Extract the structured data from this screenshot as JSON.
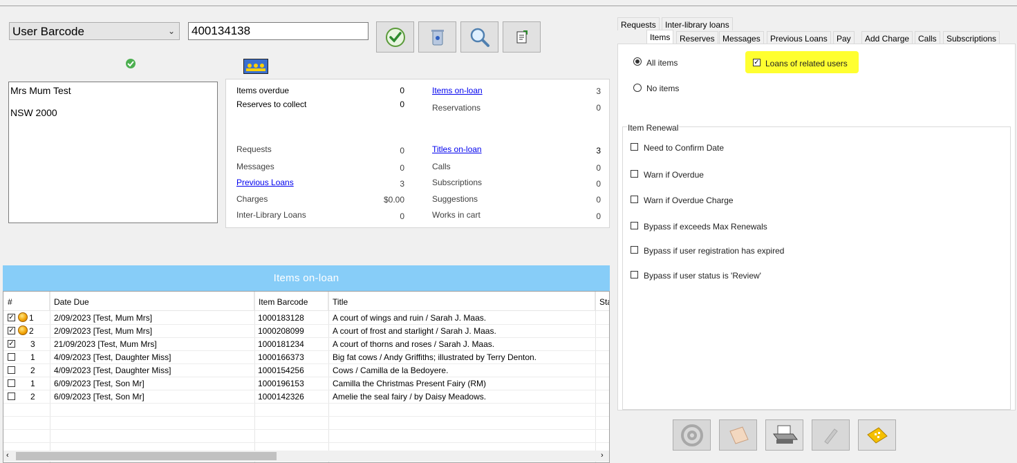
{
  "search": {
    "type_label": "User Barcode",
    "barcode_value": "400134138"
  },
  "address": {
    "lines": [
      "Mrs Mum Test",
      "NSW 2000"
    ]
  },
  "stats": {
    "items_overdue": {
      "label": "Items overdue",
      "value": "0"
    },
    "reserves_to_collect": {
      "label": "Reserves to collect",
      "value": "0"
    },
    "items_on_loan": {
      "label": "Items on-loan",
      "value": "3"
    },
    "reservations": {
      "label": "Reservations",
      "value": "0"
    },
    "requests": {
      "label": "Requests",
      "value": "0"
    },
    "titles_on_loan": {
      "label": "Titles on-loan",
      "value": "3"
    },
    "messages": {
      "label": "Messages",
      "value": "0"
    },
    "calls": {
      "label": "Calls",
      "value": "0"
    },
    "previous_loans": {
      "label": "Previous Loans",
      "value": "3"
    },
    "subscriptions": {
      "label": "Subscriptions",
      "value": "0"
    },
    "charges": {
      "label": "Charges",
      "value": "$0.00"
    },
    "suggestions": {
      "label": "Suggestions",
      "value": "0"
    },
    "ill": {
      "label": "Inter-Library Loans",
      "value": "0"
    },
    "works_in_cart": {
      "label": "Works in cart",
      "value": "0"
    }
  },
  "loans": {
    "title": "Items on-loan",
    "columns": [
      "#",
      "Date Due",
      "Item Barcode",
      "Title",
      "Sta"
    ],
    "rows": [
      {
        "checked": true,
        "coin": true,
        "num": "1",
        "due": "2/09/2023 [Test, Mum Mrs]",
        "barcode": "1000183128",
        "title": "A court of wings and ruin / Sarah J. Maas."
      },
      {
        "checked": true,
        "coin": true,
        "num": "2",
        "due": "2/09/2023 [Test, Mum Mrs]",
        "barcode": "1000208099",
        "title": "A court of frost and starlight / Sarah J. Maas."
      },
      {
        "checked": true,
        "coin": false,
        "num": "3",
        "due": "21/09/2023 [Test, Mum Mrs]",
        "barcode": "1000181234",
        "title": "A court of thorns and roses / Sarah J. Maas."
      },
      {
        "checked": false,
        "coin": false,
        "num": "1",
        "due": "4/09/2023 [Test, Daughter Miss]",
        "barcode": "1000166373",
        "title": "Big fat cows / Andy Griffiths; illustrated by Terry Denton."
      },
      {
        "checked": false,
        "coin": false,
        "num": "2",
        "due": "4/09/2023 [Test, Daughter Miss]",
        "barcode": "1000154256",
        "title": "Cows / Camilla de la Bedoyere."
      },
      {
        "checked": false,
        "coin": false,
        "num": "1",
        "due": "6/09/2023 [Test, Son Mr]",
        "barcode": "1000196153",
        "title": "Camilla the Christmas Present Fairy (RM)"
      },
      {
        "checked": false,
        "coin": false,
        "num": "2",
        "due": "6/09/2023 [Test, Son Mr]",
        "barcode": "1000142326",
        "title": "Amelie the seal fairy / by Daisy Meadows."
      }
    ]
  },
  "tabs_row1": [
    "Requests",
    "Inter-library loans"
  ],
  "tabs_row2": [
    "Items",
    "Reserves",
    "Messages",
    "Previous Loans",
    "Pay",
    "Add Charge",
    "Calls",
    "Subscriptions"
  ],
  "items_panel": {
    "all_items": "All items",
    "no_items": "No items",
    "related_loans": "Loans of related users",
    "renewal_group": "Item Renewal",
    "options": [
      "Need to Confirm Date",
      "Warn if Overdue",
      "Warn if Overdue Charge",
      "Bypass if exceeds Max Renewals",
      "Bypass if user registration has expired",
      "Bypass if user status is 'Review'"
    ]
  }
}
